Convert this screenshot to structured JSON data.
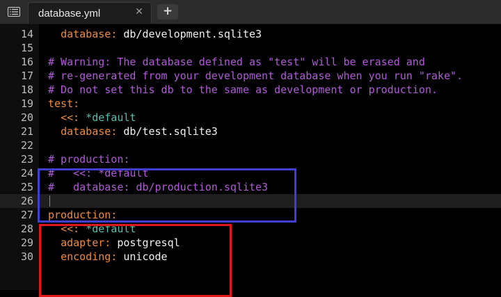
{
  "tab_bar": {
    "menu_icon": "menu-icon",
    "tab": {
      "label": "database.yml",
      "close_glyph": "✕"
    },
    "new_tab_glyph": "+"
  },
  "editor": {
    "current_line": 26,
    "lines": [
      {
        "n": "14",
        "segs": [
          {
            "t": "  "
          },
          {
            "t": "database:",
            "k": "key"
          },
          {
            "t": " db/development.sqlite3",
            "k": "val"
          }
        ]
      },
      {
        "n": "15",
        "segs": []
      },
      {
        "n": "16",
        "segs": [
          {
            "t": "# Warning: The database defined as \"test\" will be erased and",
            "k": "com"
          }
        ]
      },
      {
        "n": "17",
        "segs": [
          {
            "t": "# re-generated from your development database when you run \"rake\".",
            "k": "com"
          }
        ]
      },
      {
        "n": "18",
        "segs": [
          {
            "t": "# Do not set this db to the same as development or production.",
            "k": "com"
          }
        ]
      },
      {
        "n": "19",
        "segs": [
          {
            "t": "test:",
            "k": "key"
          }
        ]
      },
      {
        "n": "20",
        "segs": [
          {
            "t": "  "
          },
          {
            "t": "<<:",
            "k": "key"
          },
          {
            "t": " *default",
            "k": "alias"
          }
        ]
      },
      {
        "n": "21",
        "segs": [
          {
            "t": "  "
          },
          {
            "t": "database:",
            "k": "key"
          },
          {
            "t": " db/test.sqlite3",
            "k": "val"
          }
        ]
      },
      {
        "n": "22",
        "segs": []
      },
      {
        "n": "23",
        "segs": [
          {
            "t": "# production:",
            "k": "com"
          }
        ]
      },
      {
        "n": "24",
        "segs": [
          {
            "t": "#   <<: *default",
            "k": "com"
          }
        ]
      },
      {
        "n": "25",
        "segs": [
          {
            "t": "#   database: db/production.sqlite3",
            "k": "com"
          }
        ]
      },
      {
        "n": "26",
        "segs": []
      },
      {
        "n": "27",
        "segs": [
          {
            "t": "production:",
            "k": "key"
          }
        ]
      },
      {
        "n": "28",
        "segs": [
          {
            "t": "  "
          },
          {
            "t": "<<:",
            "k": "key"
          },
          {
            "t": " *default",
            "k": "alias"
          }
        ]
      },
      {
        "n": "29",
        "segs": [
          {
            "t": "  "
          },
          {
            "t": "adapter:",
            "k": "key"
          },
          {
            "t": " postgresql",
            "k": "val"
          }
        ]
      },
      {
        "n": "30",
        "segs": [
          {
            "t": "  "
          },
          {
            "t": "encoding:",
            "k": "key"
          },
          {
            "t": " unicode",
            "k": "val"
          }
        ]
      }
    ]
  },
  "colors": {
    "key": "#f08a3c",
    "value": "#f2f2f2",
    "comment": "#b05ad8",
    "alias": "#55bfae",
    "highlight_blue": "#4040d0",
    "highlight_red": "#e01818"
  }
}
